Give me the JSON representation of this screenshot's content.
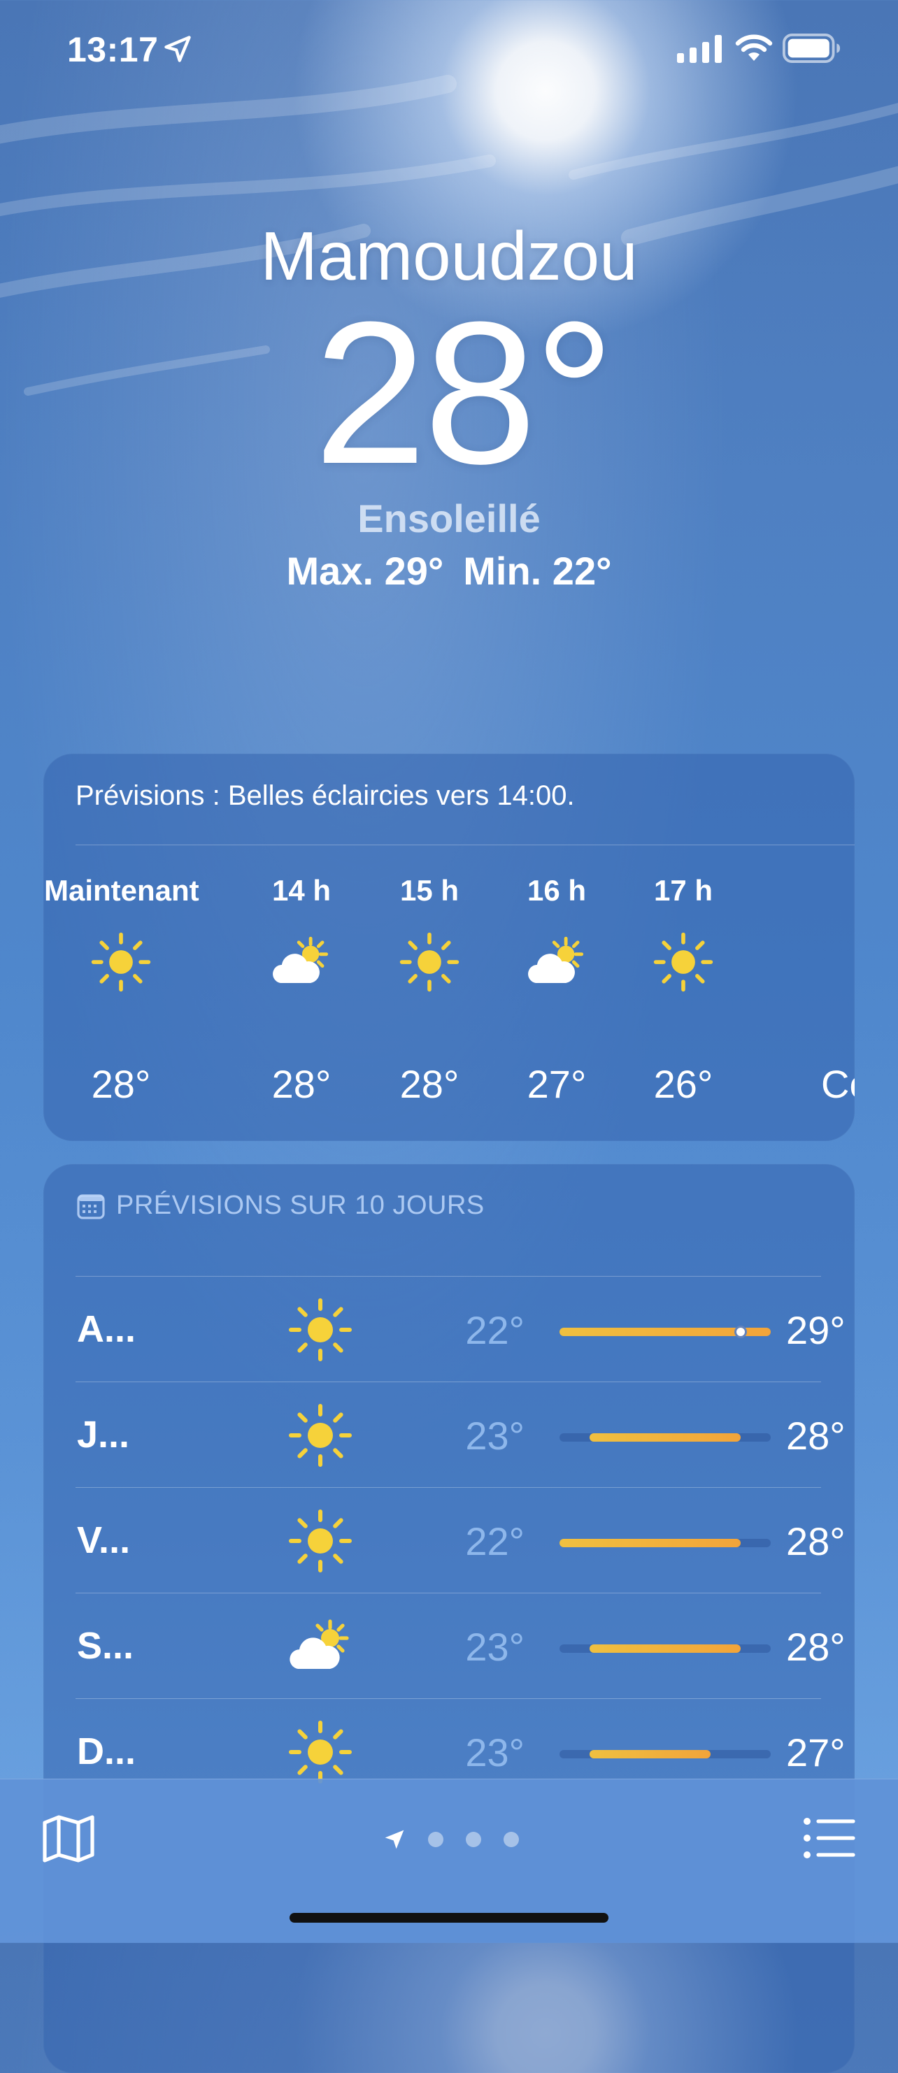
{
  "status_bar": {
    "time": "13:17",
    "icons": [
      "location-arrow-icon",
      "cellular-signal-icon",
      "wifi-icon",
      "battery-icon"
    ]
  },
  "current": {
    "city": "Mamoudzou",
    "temperature": "28°",
    "condition": "Ensoleillé",
    "high": "Max. 29°",
    "low": "Min. 22°"
  },
  "hourly": {
    "summary": "Prévisions : Belles éclaircies vers 14:00.",
    "items": [
      {
        "label": "Maintenant",
        "icon": "sun-icon",
        "temp": "28°"
      },
      {
        "label": "14 h",
        "icon": "partly-cloudy-icon",
        "temp": "28°"
      },
      {
        "label": "15 h",
        "icon": "sun-icon",
        "temp": "28°"
      },
      {
        "label": "16 h",
        "icon": "partly-cloudy-icon",
        "temp": "27°"
      },
      {
        "label": "17 h",
        "icon": "sun-icon",
        "temp": "26°"
      }
    ],
    "cutoff_text": "Co"
  },
  "daily": {
    "header": "PRÉVISIONS SUR 10 JOURS",
    "range_scale": {
      "min": 22,
      "max": 29
    },
    "items": [
      {
        "day": "A...",
        "icon": "sun-icon",
        "min": "22°",
        "max": "29°",
        "min_value": 22,
        "max_value": 29,
        "current_value": 28
      },
      {
        "day": "J...",
        "icon": "sun-icon",
        "min": "23°",
        "max": "28°",
        "min_value": 23,
        "max_value": 28
      },
      {
        "day": "V...",
        "icon": "sun-icon",
        "min": "22°",
        "max": "28°",
        "min_value": 22,
        "max_value": 28
      },
      {
        "day": "S...",
        "icon": "partly-cloudy-icon",
        "min": "23°",
        "max": "28°",
        "min_value": 23,
        "max_value": 28
      },
      {
        "day": "D...",
        "icon": "sun-icon",
        "min": "23°",
        "max": "27°",
        "min_value": 23,
        "max_value": 27
      }
    ]
  },
  "bottom_bar": {
    "page_count": 3,
    "current_page": "location"
  },
  "colors": {
    "sun": "#f6d23a",
    "bar_start": "#f0c040",
    "bar_end": "#f2a43a",
    "card": "#3465af"
  }
}
